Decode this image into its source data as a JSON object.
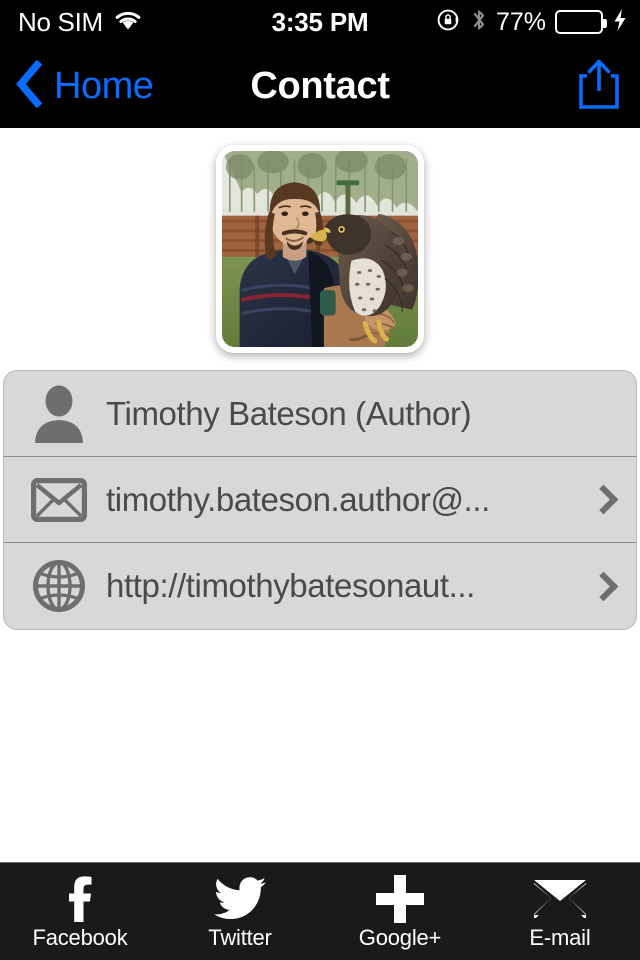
{
  "status_bar": {
    "carrier": "No SIM",
    "wifi_icon": "wifi-icon",
    "time": "3:35 PM",
    "rotation_lock_icon": "rotation-lock-icon",
    "bluetooth_icon": "bluetooth-icon",
    "battery_percent": "77%",
    "battery_level": 77,
    "battery_charging": true,
    "battery_color": "#4cd964",
    "charging_icon": "lightning-bolt-icon"
  },
  "nav_bar": {
    "back_icon": "chevron-left-icon",
    "back_label": "Home",
    "title": "Contact",
    "share_icon": "share-icon",
    "accent_color": "#0a6cff",
    "background_color": "#000000"
  },
  "profile_photo": {
    "alt": "Man holding a hawk on a gloved hand outdoors",
    "frame_color": "#ffffff"
  },
  "contact_rows": [
    {
      "icon": "person-icon",
      "label": "Timothy Bateson (Author)",
      "has_chevron": false
    },
    {
      "icon": "envelope-icon",
      "label": "timothy.bateson.author@...",
      "has_chevron": true
    },
    {
      "icon": "globe-icon",
      "label": "http://timothybatesonaut...",
      "has_chevron": true
    }
  ],
  "tab_bar": {
    "background_color": "#1a1a1a",
    "tabs": [
      {
        "icon": "facebook-icon",
        "label": "Facebook"
      },
      {
        "icon": "twitter-icon",
        "label": "Twitter"
      },
      {
        "icon": "google-plus-icon",
        "label": "Google+"
      },
      {
        "icon": "email-icon",
        "label": "E-mail"
      }
    ]
  }
}
